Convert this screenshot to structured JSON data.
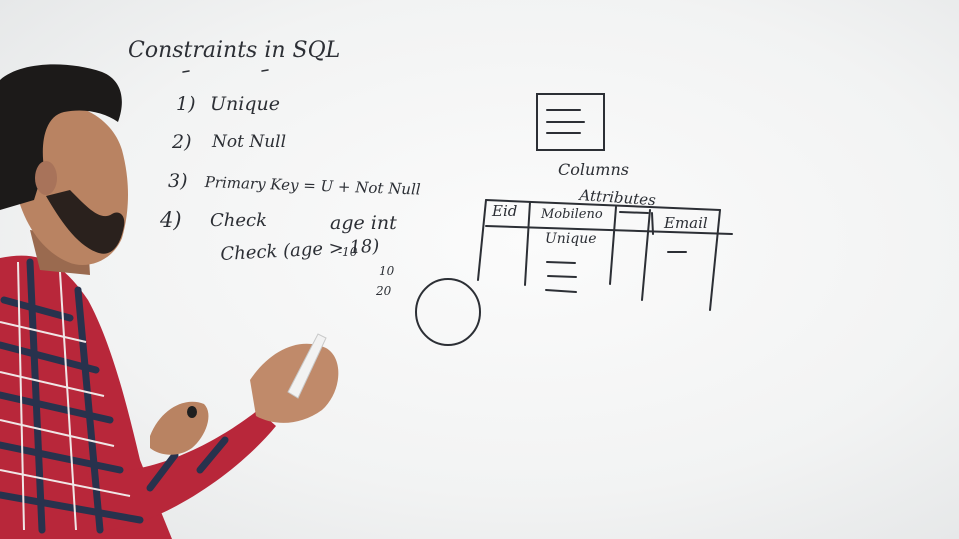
{
  "whiteboard": {
    "title": "Constraints in SQL",
    "list": [
      {
        "num": "1)",
        "text": "Unique"
      },
      {
        "num": "2)",
        "text": "Not Null"
      },
      {
        "num": "3)",
        "text": "Primary Key = U + Not Null"
      },
      {
        "num": "4)",
        "text": "Check"
      }
    ],
    "age_int": "age int",
    "check_expr": "Check (age > 18)",
    "neg_value": "-10",
    "values": [
      "10",
      "20"
    ],
    "columns_label": "Columns",
    "attributes_label": "Attributes",
    "table_headers": [
      "Eid",
      "Mobileno",
      "",
      "Email"
    ],
    "unique_note": "Unique"
  },
  "colors": {
    "board": "#f5f6f6",
    "marker_ink": "#2c2f35",
    "shirt_red": "#c8283a",
    "shirt_navy": "#2a3450",
    "skin": "#b98362",
    "hair": "#1c1a19"
  }
}
